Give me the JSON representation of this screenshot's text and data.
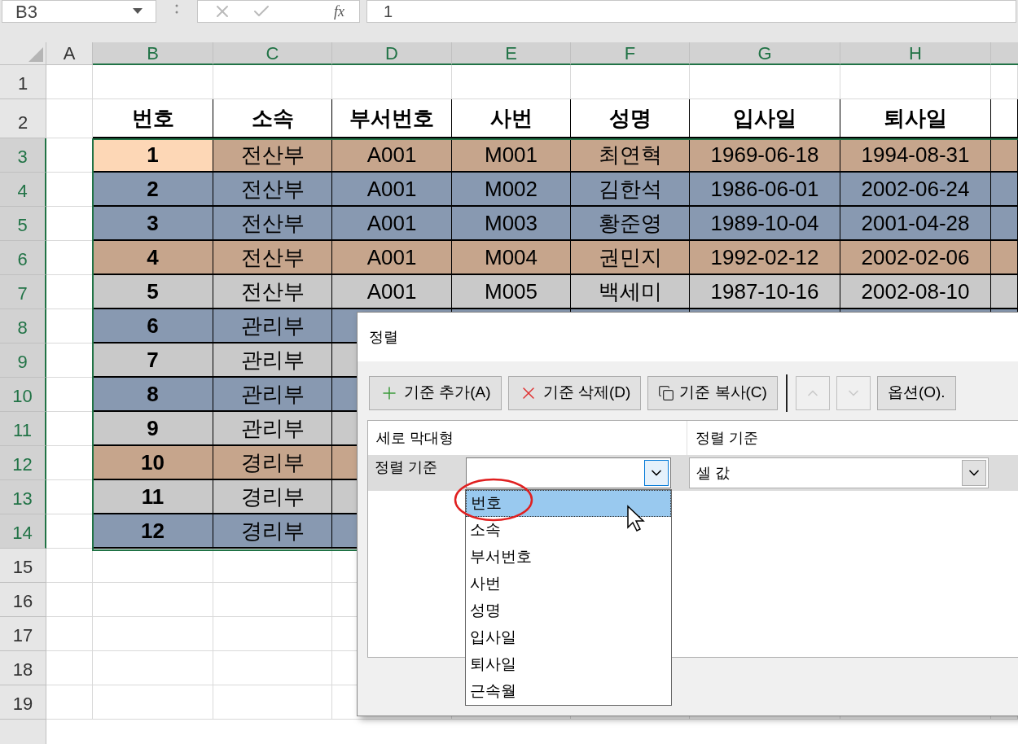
{
  "formula_bar": {
    "name_box": "B3",
    "function_label": "fx",
    "formula": "1"
  },
  "columns": [
    {
      "label": "A",
      "selected": false
    },
    {
      "label": "B",
      "selected": true
    },
    {
      "label": "C",
      "selected": true
    },
    {
      "label": "D",
      "selected": true
    },
    {
      "label": "E",
      "selected": true
    },
    {
      "label": "F",
      "selected": true
    },
    {
      "label": "G",
      "selected": true
    },
    {
      "label": "H",
      "selected": true
    }
  ],
  "row_numbers": [
    {
      "label": "1",
      "selected": false
    },
    {
      "label": "2",
      "selected": false
    },
    {
      "label": "3",
      "selected": true
    },
    {
      "label": "4",
      "selected": true
    },
    {
      "label": "5",
      "selected": true
    },
    {
      "label": "6",
      "selected": true
    },
    {
      "label": "7",
      "selected": true
    },
    {
      "label": "8",
      "selected": true
    },
    {
      "label": "9",
      "selected": true
    },
    {
      "label": "10",
      "selected": true
    },
    {
      "label": "11",
      "selected": true
    },
    {
      "label": "12",
      "selected": true
    },
    {
      "label": "13",
      "selected": true
    },
    {
      "label": "14",
      "selected": true
    },
    {
      "label": "15",
      "selected": false
    },
    {
      "label": "16",
      "selected": false
    },
    {
      "label": "17",
      "selected": false
    },
    {
      "label": "18",
      "selected": false
    },
    {
      "label": "19",
      "selected": false
    }
  ],
  "table": {
    "headers": [
      "번호",
      "소속",
      "부서번호",
      "사번",
      "성명",
      "입사일",
      "퇴사일"
    ],
    "rows": [
      {
        "color": "#c6a58c",
        "active": true,
        "cells": [
          "1",
          "전산부",
          "A001",
          "M001",
          "최연혁",
          "1969-06-18",
          "1994-08-31"
        ]
      },
      {
        "color": "#8899b1",
        "active": false,
        "cells": [
          "2",
          "전산부",
          "A001",
          "M002",
          "김한석",
          "1986-06-01",
          "2002-06-24"
        ]
      },
      {
        "color": "#8899b1",
        "active": false,
        "cells": [
          "3",
          "전산부",
          "A001",
          "M003",
          "황준영",
          "1989-10-04",
          "2001-04-28"
        ]
      },
      {
        "color": "#c6a58c",
        "active": false,
        "cells": [
          "4",
          "전산부",
          "A001",
          "M004",
          "권민지",
          "1992-02-12",
          "2002-02-06"
        ]
      },
      {
        "color": "#c9c9c9",
        "active": false,
        "cells": [
          "5",
          "전산부",
          "A001",
          "M005",
          "백세미",
          "1987-10-16",
          "2002-08-10"
        ]
      },
      {
        "color": "#8899b1",
        "active": false,
        "cells": [
          "6",
          "관리부"
        ]
      },
      {
        "color": "#c9c9c9",
        "active": false,
        "cells": [
          "7",
          "관리부"
        ]
      },
      {
        "color": "#8899b1",
        "active": false,
        "cells": [
          "8",
          "관리부"
        ]
      },
      {
        "color": "#c9c9c9",
        "active": false,
        "cells": [
          "9",
          "관리부"
        ]
      },
      {
        "color": "#c6a58c",
        "active": false,
        "cells": [
          "10",
          "경리부"
        ]
      },
      {
        "color": "#c9c9c9",
        "active": false,
        "cells": [
          "11",
          "경리부"
        ]
      },
      {
        "color": "#8899b1",
        "active": false,
        "cells": [
          "12",
          "경리부"
        ]
      }
    ]
  },
  "dialog": {
    "title": "정렬",
    "toolbar": [
      {
        "kind": "add",
        "label": "기준 추가(A)"
      },
      {
        "kind": "delete",
        "label": "기준 삭제(D)"
      },
      {
        "kind": "copy",
        "label": "기준 복사(C)"
      },
      {
        "kind": "up",
        "disabled": true
      },
      {
        "kind": "down",
        "disabled": true
      },
      {
        "kind": "options",
        "label": "옵션(O)."
      }
    ],
    "grid_headers": [
      "세로 막대형",
      "정렬 기준"
    ],
    "row_label": "정렬 기준",
    "sort_on": "셀 값",
    "dropdown_items": [
      {
        "label": "번호",
        "selected": true
      },
      {
        "label": "소속",
        "selected": false
      },
      {
        "label": "부서번호",
        "selected": false
      },
      {
        "label": "사번",
        "selected": false
      },
      {
        "label": "성명",
        "selected": false
      },
      {
        "label": "입사일",
        "selected": false
      },
      {
        "label": "퇴사일",
        "selected": false
      },
      {
        "label": "근속월",
        "selected": false
      }
    ]
  }
}
